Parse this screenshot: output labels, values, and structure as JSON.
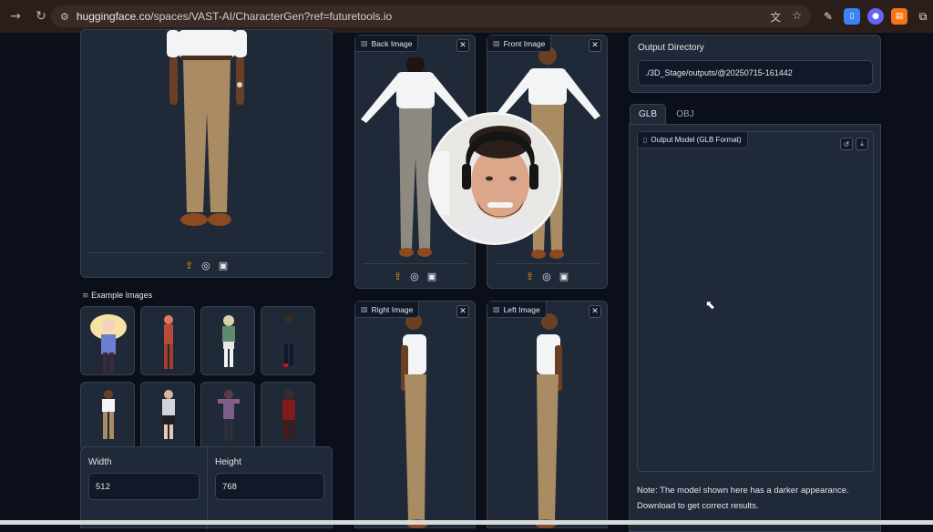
{
  "browser": {
    "url_host": "huggingface.co",
    "url_path": "/spaces/VAST-AI/CharacterGen?ref=futuretools.io",
    "back_icon": "arrow-right-icon",
    "reload_icon": "reload-icon"
  },
  "input_view": {
    "toolbar_icons": [
      "upload-icon",
      "webcam-icon",
      "clipboard-icon"
    ]
  },
  "examples": {
    "title": "Example Images",
    "count": 8
  },
  "size": {
    "width_label": "Width",
    "width_value": "512",
    "height_label": "Height",
    "height_value": "768"
  },
  "views": {
    "back_label": "Back Image",
    "front_label": "Front Image",
    "right_label": "Right Image",
    "left_label": "Left Image"
  },
  "output": {
    "directory_label": "Output Directory",
    "directory_value": "./3D_Stage/outputs/@20250715-161442",
    "tabs": [
      "GLB",
      "OBJ"
    ],
    "active_tab": "GLB",
    "model_label": "Output Model (GLB Format)",
    "note": "Note: The model shown here has a darker appearance. Download to get correct results."
  },
  "colors": {
    "accent_orange": "#f59e0b",
    "panel_bg": "#1f2937",
    "page_bg": "#0b0f19"
  }
}
